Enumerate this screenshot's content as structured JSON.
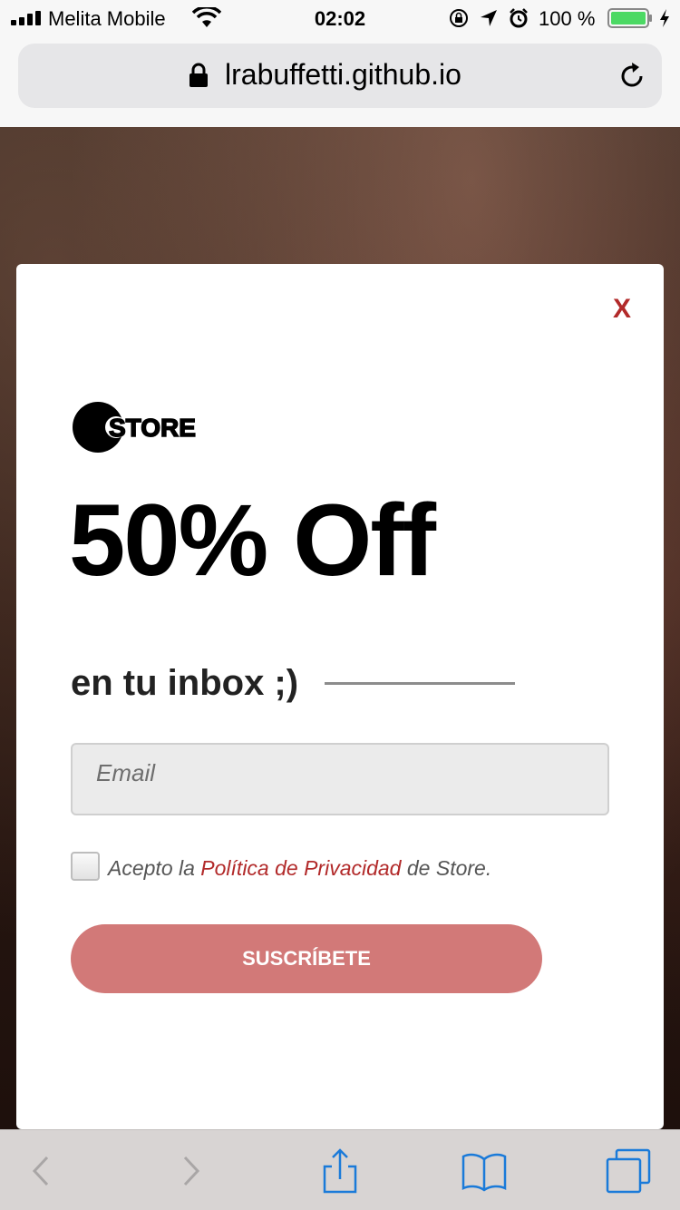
{
  "status_bar": {
    "carrier": "Melita Mobile",
    "time": "02:02",
    "battery_percent": "100 %",
    "icons": [
      "signal-icon",
      "wifi-icon",
      "orientation-lock-icon",
      "location-icon",
      "alarm-icon",
      "battery-icon",
      "charging-icon"
    ]
  },
  "browser": {
    "url": "lrabuffetti.github.io",
    "icons": [
      "lock-icon",
      "reload-icon"
    ]
  },
  "modal": {
    "close_label": "X",
    "logo_text": "STORE",
    "headline": "50% Off",
    "subheadline": "en tu inbox ;)",
    "email_placeholder": "Email",
    "consent_prefix": "Acepto la ",
    "consent_link": "Política de Privacidad",
    "consent_suffix": " de Store.",
    "subscribe_label": "SUSCRÍBETE",
    "colors": {
      "accent": "#b22a2a",
      "button": "#d27978"
    }
  },
  "toolbar": {
    "icons": [
      "back-icon",
      "forward-icon",
      "share-icon",
      "bookmarks-icon",
      "tabs-icon"
    ]
  }
}
